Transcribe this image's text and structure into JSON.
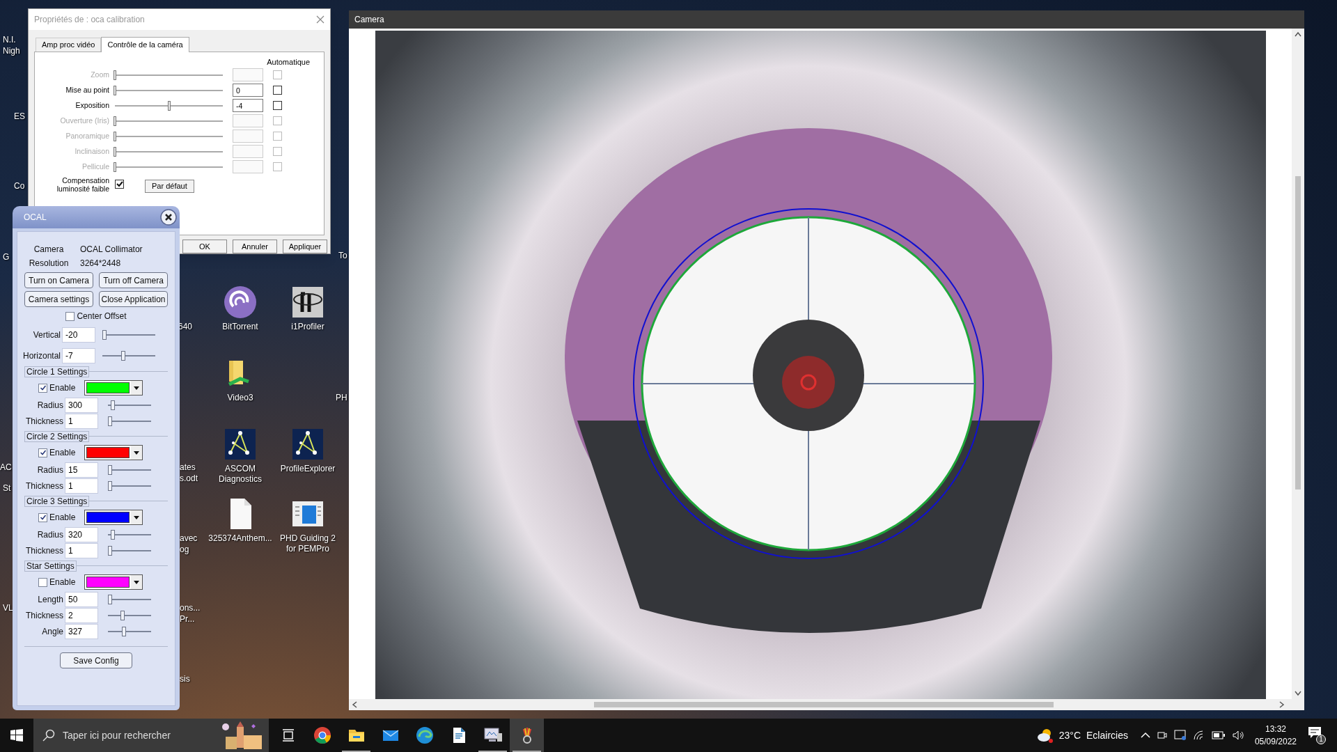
{
  "desktop": {
    "icons": [
      {
        "kind": "swirl",
        "label": "BitTorrent"
      },
      {
        "kind": "tile",
        "label": "i1Profiler"
      },
      {
        "kind": "folder",
        "label": "Video3"
      },
      {
        "kind": "constellation",
        "label": "ASCOM Diagnostics"
      },
      {
        "kind": "constellation",
        "label": "ProfileExplorer"
      },
      {
        "kind": "document",
        "label": "325374Anthem..."
      },
      {
        "kind": "window",
        "label": "PHD Guiding 2 for PEMPro"
      }
    ],
    "partial_labels": [
      "N.I.",
      "Nigh",
      "ES",
      "Co",
      "G",
      "AC",
      "St",
      "VL",
      "640",
      "ates",
      "s.odt",
      "avec",
      "og",
      "ons...",
      "Pr...",
      "sis",
      "To",
      "PH"
    ]
  },
  "properties_dialog": {
    "title": "Propriétés de : oca calibration",
    "tabs": [
      {
        "label": "Amp proc vidéo",
        "selected": false
      },
      {
        "label": "Contrôle de la caméra",
        "selected": true
      }
    ],
    "auto_header": "Automatique",
    "controls": [
      {
        "label": "Zoom",
        "disabled": true,
        "level": 0,
        "auto": false
      },
      {
        "label": "Mise au point",
        "disabled": false,
        "level": 0,
        "value": "0",
        "auto": false
      },
      {
        "label": "Exposition",
        "disabled": false,
        "level": 0.5,
        "value": "-4",
        "auto": false
      },
      {
        "label": "Ouverture (Iris)",
        "disabled": true,
        "level": 0,
        "auto": false
      },
      {
        "label": "Panoramique",
        "disabled": true,
        "level": 0,
        "auto": false
      },
      {
        "label": "Inclinaison",
        "disabled": true,
        "level": 0,
        "auto": false
      },
      {
        "label": "Pellicule",
        "disabled": true,
        "level": 0,
        "auto": false
      }
    ],
    "low_light": {
      "label": "Compensation luminosité faible",
      "checked": true
    },
    "default_button": "Par défaut",
    "buttons": [
      "OK",
      "Annuler",
      "Appliquer"
    ]
  },
  "ocal": {
    "title": "OCAL",
    "info": [
      {
        "label": "Camera",
        "value": "OCAL Collimator"
      },
      {
        "label": "Resolution",
        "value": "3264*2448"
      }
    ],
    "buttons": [
      "Turn on Camera",
      "Turn off Camera",
      "Camera settings",
      "Close Application"
    ],
    "center_offset": {
      "label": "Center Offset",
      "checked": false
    },
    "offsets": [
      {
        "label": "Vertical",
        "value": "-20",
        "level": 0
      },
      {
        "label": "Horizontal",
        "value": "-7",
        "level": 0.38
      }
    ],
    "groups": [
      {
        "title": "Circle 1 Settings",
        "enable": {
          "label": "Enable",
          "checked": true
        },
        "color": "#00ff00",
        "fields": [
          {
            "label": "Radius",
            "value": "300",
            "level": 0.08
          },
          {
            "label": "Thickness",
            "value": "1",
            "level": 0
          }
        ]
      },
      {
        "title": "Circle 2 Settings",
        "enable": {
          "label": "Enable",
          "checked": true
        },
        "color": "#ff0000",
        "fields": [
          {
            "label": "Radius",
            "value": "15",
            "level": 0
          },
          {
            "label": "Thickness",
            "value": "1",
            "level": 0
          }
        ]
      },
      {
        "title": "Circle 3 Settings",
        "enable": {
          "label": "Enable",
          "checked": true
        },
        "color": "#0000ff",
        "fields": [
          {
            "label": "Radius",
            "value": "320",
            "level": 0.08
          },
          {
            "label": "Thickness",
            "value": "1",
            "level": 0
          }
        ]
      },
      {
        "title": "Star Settings",
        "enable": {
          "label": "Enable",
          "checked": false
        },
        "color": "#ff00ff",
        "fields": [
          {
            "label": "Length",
            "value": "50",
            "level": 0
          },
          {
            "label": "Thickness",
            "value": "2",
            "level": 0.33
          },
          {
            "label": "Angle",
            "value": "327",
            "level": 0.36
          }
        ]
      }
    ],
    "save_button": "Save Config"
  },
  "camera_window": {
    "title": "Camera"
  },
  "taskbar": {
    "search": {
      "placeholder": "Taper ici pour rechercher"
    },
    "apps": [
      {
        "kind": "chrome",
        "selected": false,
        "running": false
      },
      {
        "kind": "explorer",
        "selected": false,
        "running": true
      },
      {
        "kind": "mail",
        "selected": false,
        "running": false
      },
      {
        "kind": "edge",
        "selected": false,
        "running": false
      },
      {
        "kind": "writer",
        "selected": false,
        "running": false
      },
      {
        "kind": "monitor",
        "selected": false,
        "running": true
      },
      {
        "kind": "ocal",
        "selected": true,
        "running": true
      }
    ],
    "weather": {
      "temperature": "23°C",
      "condition": "Eclaircies"
    },
    "time": "13:32",
    "date": "05/09/2022",
    "notification_count": "1"
  }
}
